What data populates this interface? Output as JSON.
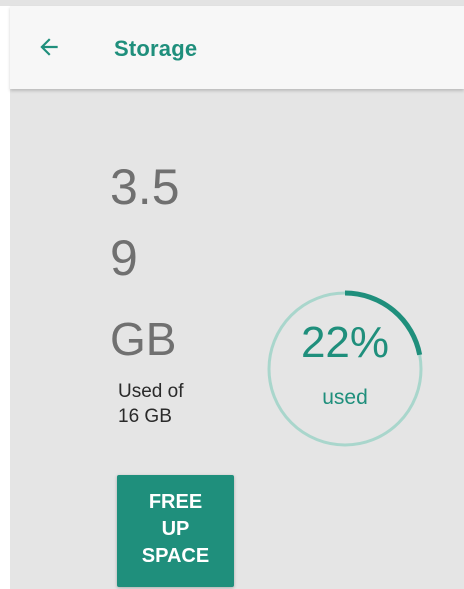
{
  "appbar": {
    "title": "Storage",
    "back_icon": "arrow-left-icon"
  },
  "storage": {
    "amount_line1": "3.5",
    "amount_line2": "9",
    "amount_unit": "GB",
    "used_of_text": "Used of\n16 GB",
    "used_percent": 22,
    "used_percent_label": "22%",
    "used_label": "used"
  },
  "actions": {
    "free_up_label": "FREE\nUP\nSPACE"
  },
  "colors": {
    "accent": "#1f8f7c",
    "ring_track": "#a9d6cc",
    "background": "#e5e5e5",
    "appbar": "#f7f7f7"
  }
}
